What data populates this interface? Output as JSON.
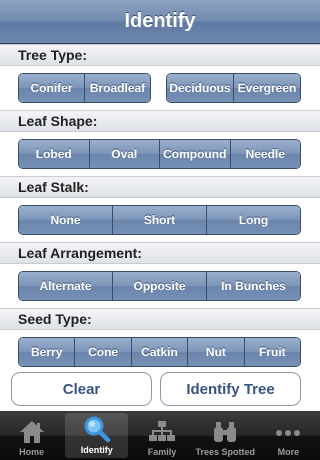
{
  "nav": {
    "title": "Identify"
  },
  "sections": {
    "tree_type": {
      "header": "Tree Type:",
      "group1": [
        "Conifer",
        "Broadleaf"
      ],
      "group2": [
        "Deciduous",
        "Evergreen"
      ]
    },
    "leaf_shape": {
      "header": "Leaf Shape:",
      "options": [
        "Lobed",
        "Oval",
        "Compound",
        "Needle"
      ]
    },
    "leaf_stalk": {
      "header": "Leaf Stalk:",
      "options": [
        "None",
        "Short",
        "Long"
      ]
    },
    "leaf_arrangement": {
      "header": "Leaf Arrangement:",
      "options": [
        "Alternate",
        "Opposite",
        "In Bunches"
      ]
    },
    "seed_type": {
      "header": "Seed Type:",
      "options": [
        "Berry",
        "Cone",
        "Catkin",
        "Nut",
        "Fruit"
      ]
    }
  },
  "actions": {
    "clear": "Clear",
    "identify": "Identify Tree"
  },
  "tabs": [
    {
      "label": "Home",
      "icon": "house-icon"
    },
    {
      "label": "Identify",
      "icon": "magnifier-icon"
    },
    {
      "label": "Family",
      "icon": "hierarchy-icon"
    },
    {
      "label": "Trees Spotted",
      "icon": "binoculars-icon"
    },
    {
      "label": "More",
      "icon": "more-dots-icon"
    }
  ],
  "colors": {
    "nav_blue": "#6d86ad",
    "segment_blue": "#7b94b8",
    "button_text": "#385487",
    "tabbar": "#1a1a1a",
    "active_icon": "#4aa2e8"
  }
}
